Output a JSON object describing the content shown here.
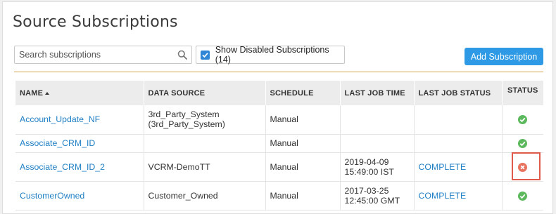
{
  "page": {
    "title": "Source Subscriptions"
  },
  "toolbar": {
    "search_placeholder": "Search subscriptions",
    "search_value": "",
    "show_disabled_label": "Show Disabled Subscriptions (14)",
    "show_disabled_checked": true,
    "add_button_label": "Add Subscription"
  },
  "table": {
    "columns": [
      "NAME",
      "DATA SOURCE",
      "SCHEDULE",
      "LAST JOB TIME",
      "LAST JOB STATUS",
      "STATUS"
    ],
    "sort": {
      "column": "NAME",
      "direction": "ascending"
    },
    "rows": [
      {
        "name": "Account_Update_NF",
        "data_source": "3rd_Party_System\n(3rd_Party_System)",
        "schedule": "Manual",
        "last_job_time": "",
        "last_job_status": "",
        "status": "ok"
      },
      {
        "name": "Associate_CRM_ID",
        "data_source": "",
        "schedule": "Manual",
        "last_job_time": "",
        "last_job_status": "",
        "status": "ok"
      },
      {
        "name": "Associate_CRM_ID_2",
        "data_source": "VCRM-DemoTT",
        "schedule": "Manual",
        "last_job_time": "2019-04-09\n15:49:00 IST",
        "last_job_status": "COMPLETE",
        "status": "error"
      },
      {
        "name": "CustomerOwned",
        "data_source": "Customer_Owned",
        "schedule": "Manual",
        "last_job_time": "2017-03-25\n12:45:00 GMT",
        "last_job_status": "COMPLETE",
        "status": "ok"
      }
    ]
  },
  "colors": {
    "accent": "#2e9ae6",
    "link": "#1f7fc4",
    "ok": "#5cb85c",
    "error": "#e8735f",
    "rule": "#d7a54a",
    "highlight": "#e05a4c"
  }
}
